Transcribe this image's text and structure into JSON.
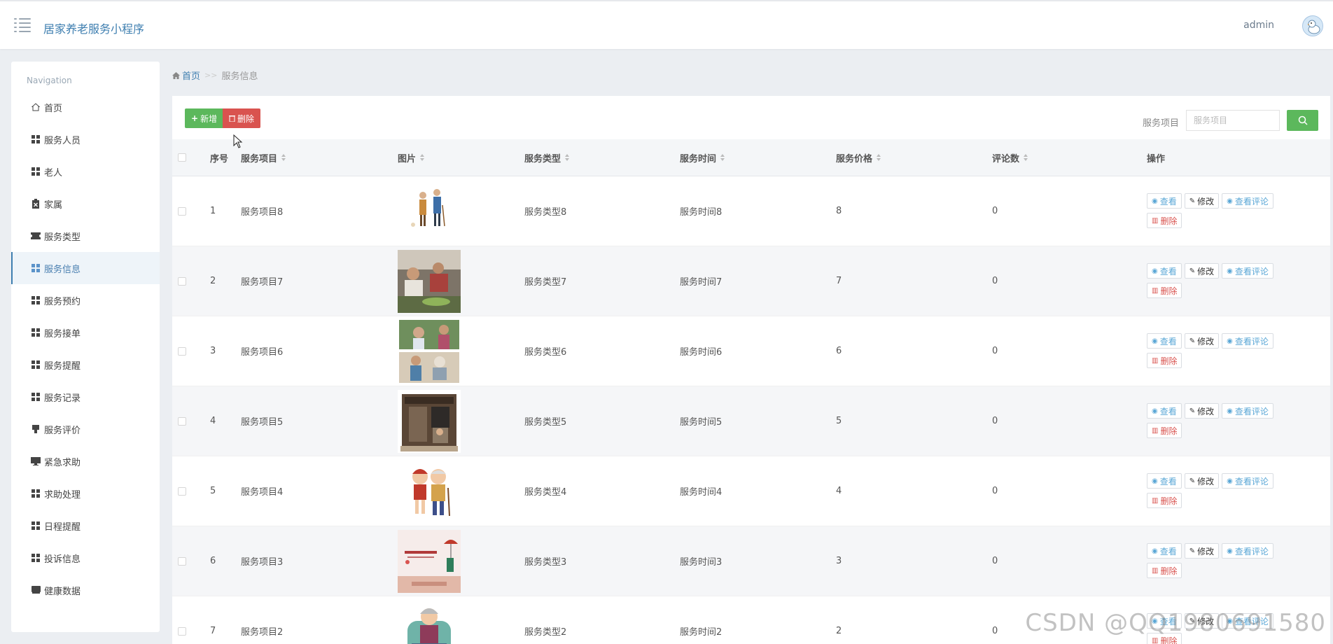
{
  "header": {
    "title": "居家养老服务小程序",
    "user": "admin"
  },
  "sidebar": {
    "heading": "Navigation",
    "items": [
      {
        "label": "首页",
        "icon": "home-icon"
      },
      {
        "label": "服务人员",
        "icon": "grid-icon"
      },
      {
        "label": "老人",
        "icon": "grid-icon"
      },
      {
        "label": "家属",
        "icon": "clipboard-icon"
      },
      {
        "label": "服务类型",
        "icon": "ticket-icon"
      },
      {
        "label": "服务信息",
        "icon": "grid-icon",
        "active": true
      },
      {
        "label": "服务预约",
        "icon": "grid-icon"
      },
      {
        "label": "服务接单",
        "icon": "grid-icon"
      },
      {
        "label": "服务提醒",
        "icon": "grid-icon"
      },
      {
        "label": "服务记录",
        "icon": "grid-icon"
      },
      {
        "label": "服务评价",
        "icon": "flag-icon"
      },
      {
        "label": "紧急求助",
        "icon": "monitor-icon"
      },
      {
        "label": "求助处理",
        "icon": "grid-icon"
      },
      {
        "label": "日程提醒",
        "icon": "grid-icon"
      },
      {
        "label": "投诉信息",
        "icon": "grid-icon"
      },
      {
        "label": "健康数据",
        "icon": "book-icon"
      }
    ]
  },
  "breadcrumb": {
    "home": "首页",
    "separator": ">>",
    "current": "服务信息"
  },
  "toolbar": {
    "add_label": "新增",
    "delete_label": "删除"
  },
  "search": {
    "label": "服务项目",
    "placeholder": "服务项目",
    "value": ""
  },
  "table": {
    "headers": {
      "index": "序号",
      "item": "服务项目",
      "image": "图片",
      "type": "服务类型",
      "time": "服务时间",
      "price": "服务价格",
      "comments": "评论数",
      "actions": "操作"
    },
    "actions": {
      "view": "查看",
      "edit": "修改",
      "view_comments": "查看评论",
      "delete": "删除"
    },
    "rows": [
      {
        "index": "1",
        "item": "服务项目8",
        "type": "服务类型8",
        "time": "服务时间8",
        "price": "8",
        "comments": "0",
        "image": "elderly-couple-walking"
      },
      {
        "index": "2",
        "item": "服务项目7",
        "type": "服务类型7",
        "time": "服务时间7",
        "price": "7",
        "comments": "0",
        "image": "people-cooking"
      },
      {
        "index": "3",
        "item": "服务项目6",
        "type": "服务类型6",
        "time": "服务时间6",
        "price": "6",
        "comments": "0",
        "image": "care-collage"
      },
      {
        "index": "4",
        "item": "服务项目5",
        "type": "服务类型5",
        "time": "服务时间5",
        "price": "5",
        "comments": "0",
        "image": "old-doorway-figurine"
      },
      {
        "index": "5",
        "item": "服务项目4",
        "type": "服务类型4",
        "time": "服务时间4",
        "price": "4",
        "comments": "0",
        "image": "cartoon-elderly-couple"
      },
      {
        "index": "6",
        "item": "服务项目3",
        "type": "服务类型3",
        "time": "服务时间3",
        "price": "3",
        "comments": "0",
        "image": "poster-umbrella"
      },
      {
        "index": "7",
        "item": "服务项目2",
        "type": "服务类型2",
        "time": "服务时间2",
        "price": "2",
        "comments": "0",
        "image": "grandma-armchair"
      }
    ]
  },
  "watermark": "CSDN @QQ1980691580",
  "colors": {
    "primary": "#3f7fb0",
    "success": "#5cb85c",
    "danger": "#d9534f",
    "link": "#5aa7d6"
  }
}
